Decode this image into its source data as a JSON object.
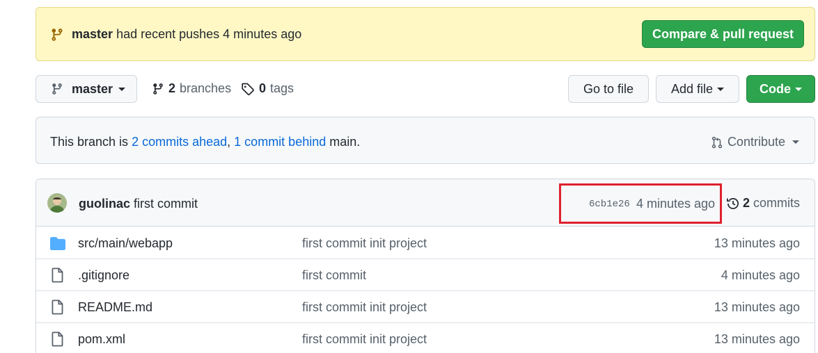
{
  "banner": {
    "branch": "master",
    "text": "had recent pushes 4 minutes ago",
    "compare_label": "Compare & pull request",
    "icon": "git-branch-icon"
  },
  "toolbar": {
    "branch_label": "master",
    "branches_count": "2",
    "branches_label": "branches",
    "tags_count": "0",
    "tags_label": "tags",
    "goto_file_label": "Go to file",
    "add_file_label": "Add file",
    "code_label": "Code"
  },
  "ahead_bar": {
    "prefix": "This branch is",
    "ahead_link": "2 commits ahead",
    "separator": ",",
    "behind_link": "1 commit behind",
    "suffix": "main.",
    "contribute_label": "Contribute"
  },
  "latest_commit": {
    "author": "guolinac",
    "message": "first commit",
    "hash": "6cb1e26",
    "time": "4 minutes ago",
    "commits_count": "2",
    "commits_label": "commits"
  },
  "files": [
    {
      "name": "src/main/webapp",
      "type": "folder",
      "message": "first commit init project",
      "time": "13 minutes ago"
    },
    {
      "name": ".gitignore",
      "type": "file",
      "message": "first commit",
      "time": "4 minutes ago"
    },
    {
      "name": "README.md",
      "type": "file",
      "message": "first commit init project",
      "time": "13 minutes ago"
    },
    {
      "name": "pom.xml",
      "type": "file",
      "message": "first commit init project",
      "time": "13 minutes ago"
    }
  ],
  "colors": {
    "banner_bg": "#fff8c5",
    "green": "#2da44e",
    "link": "#0969da",
    "highlight": "#e0202d",
    "folder": "#54aeff"
  }
}
